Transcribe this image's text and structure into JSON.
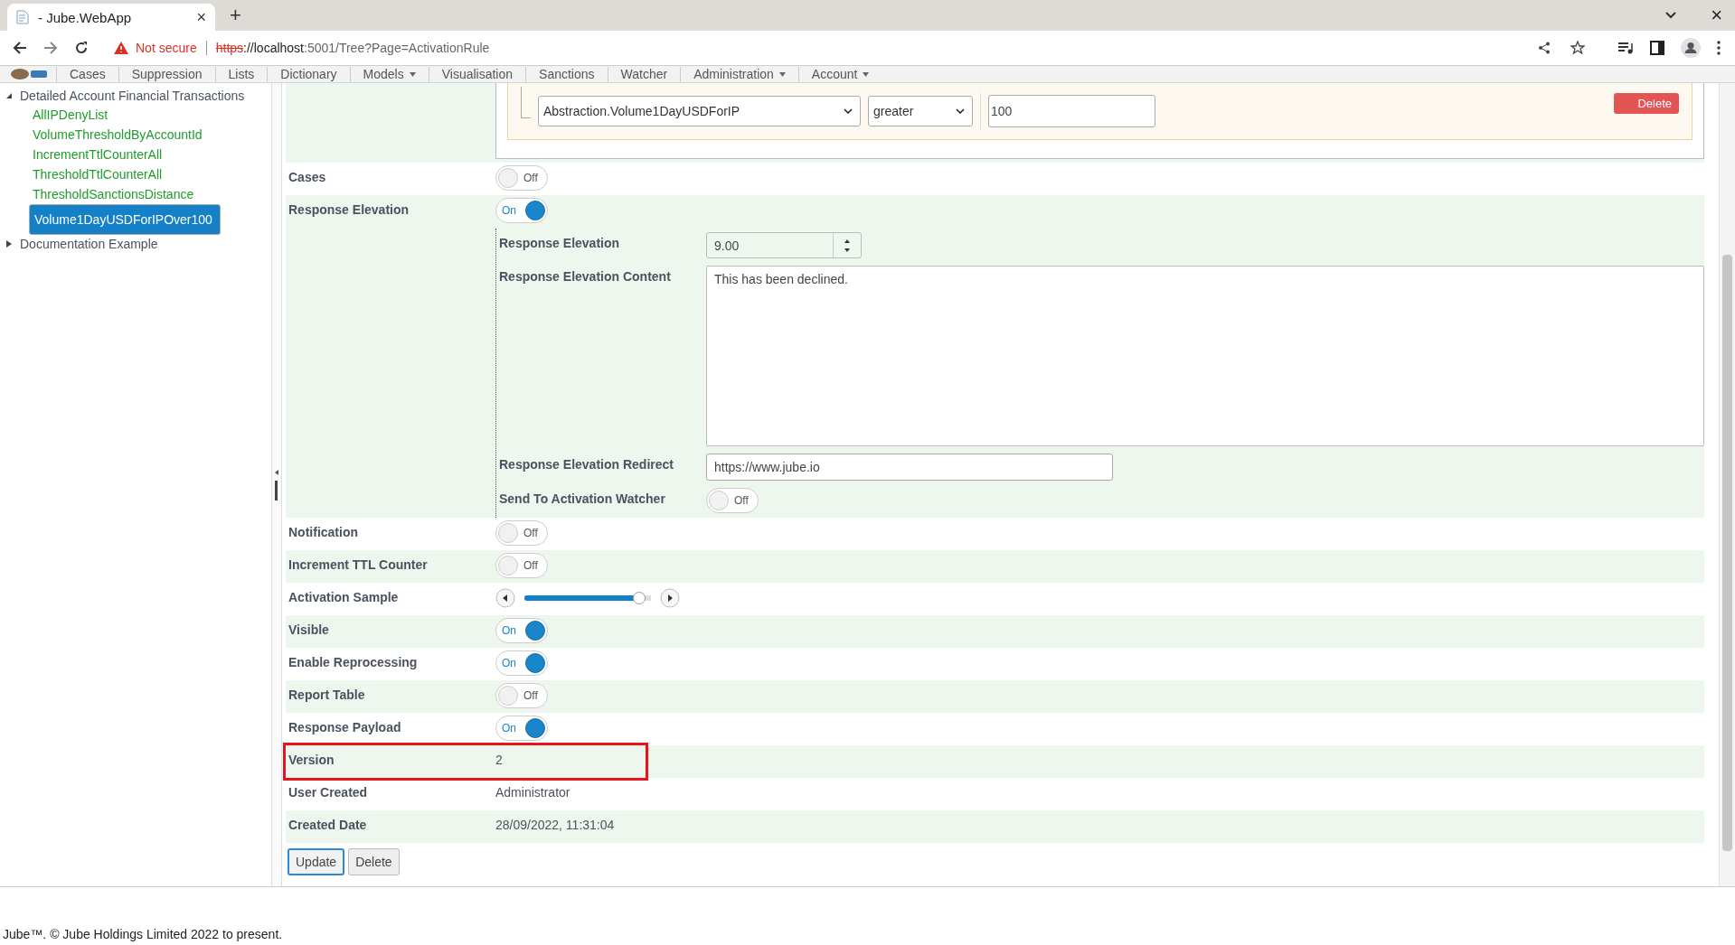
{
  "browser": {
    "tab_title": "- Jube.WebApp",
    "tab_close": "×",
    "new_tab": "+",
    "window_close": "×",
    "security": "Not secure",
    "url_scheme": "https",
    "url_host": "://localhost",
    "url_path": ":5001/Tree?Page=ActivationRule"
  },
  "nav": [
    {
      "label": "Cases",
      "dropdown": false
    },
    {
      "label": "Suppression",
      "dropdown": false
    },
    {
      "label": "Lists",
      "dropdown": false
    },
    {
      "label": "Dictionary",
      "dropdown": false
    },
    {
      "label": "Models",
      "dropdown": true
    },
    {
      "label": "Visualisation",
      "dropdown": false
    },
    {
      "label": "Sanctions",
      "dropdown": false
    },
    {
      "label": "Watcher",
      "dropdown": false
    },
    {
      "label": "Administration",
      "dropdown": true
    },
    {
      "label": "Account",
      "dropdown": true
    }
  ],
  "tree": [
    {
      "label": "Detailed Account Financial Transactions",
      "expanded": true,
      "children": [
        {
          "label": "AllIPDenyList",
          "selected": false
        },
        {
          "label": "VolumeThresholdByAccountId",
          "selected": false
        },
        {
          "label": "IncrementTtlCounterAll",
          "selected": false
        },
        {
          "label": "ThresholdTtlCounterAll",
          "selected": false
        },
        {
          "label": "ThresholdSanctionsDistance",
          "selected": false
        },
        {
          "label": "Volume1DayUSDForIPOver100",
          "selected": true
        }
      ]
    },
    {
      "label": "Documentation Example",
      "expanded": false
    }
  ],
  "filter": {
    "field": "Abstraction.Volume1DayUSDForIP",
    "operator": "greater",
    "value": "100",
    "delete": "Delete"
  },
  "rows": [
    {
      "kind": "toggle",
      "label": "Cases",
      "on": false,
      "text": "Off"
    },
    {
      "kind": "group",
      "label": "Response Elevation",
      "on": true,
      "text": "On",
      "children": [
        {
          "kind": "number",
          "label": "Response Elevation",
          "value": "9.00"
        },
        {
          "kind": "textarea",
          "label": "Response Elevation Content",
          "value": "This has been declined."
        },
        {
          "kind": "input",
          "label": "Response Elevation Redirect",
          "value": "https://www.jube.io"
        },
        {
          "kind": "toggle",
          "label": "Send To Activation Watcher",
          "on": false,
          "text": "Off"
        }
      ]
    },
    {
      "kind": "toggle",
      "label": "Notification",
      "on": false,
      "text": "Off"
    },
    {
      "kind": "toggle",
      "label": "Increment TTL Counter",
      "on": false,
      "text": "Off"
    },
    {
      "kind": "slider",
      "label": "Activation Sample",
      "level": 0.95
    },
    {
      "kind": "toggle",
      "label": "Visible",
      "on": true,
      "text": "On"
    },
    {
      "kind": "toggle",
      "label": "Enable Reprocessing",
      "on": true,
      "text": "On"
    },
    {
      "kind": "toggle",
      "label": "Report Table",
      "on": false,
      "text": "Off"
    },
    {
      "kind": "toggle",
      "label": "Response Payload",
      "on": true,
      "text": "On"
    },
    {
      "kind": "text",
      "label": "Version",
      "value": "2",
      "highlighted": true
    },
    {
      "kind": "text",
      "label": "User Created",
      "value": "Administrator",
      "highlighted": false
    },
    {
      "kind": "text",
      "label": "Created Date",
      "value": "28/09/2022, 11:31:04",
      "highlighted": false
    }
  ],
  "buttons": [
    {
      "label": "Update",
      "focused": true
    },
    {
      "label": "Delete",
      "focused": false
    }
  ],
  "footer": "Jube™. © Jube Holdings Limited 2022 to present."
}
